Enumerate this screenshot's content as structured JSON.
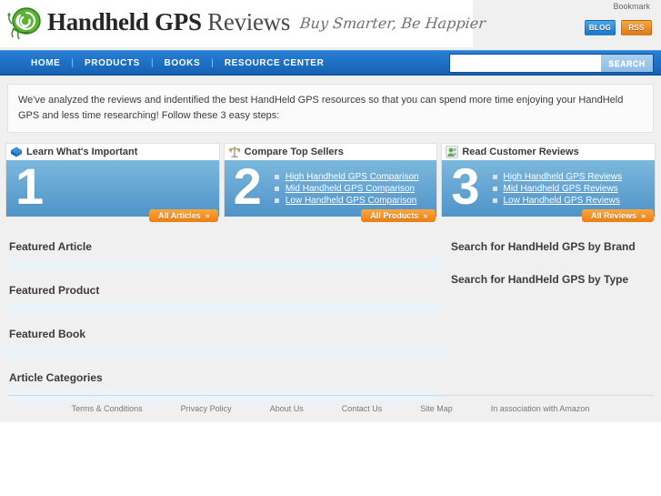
{
  "header": {
    "brand_bold": "Handheld GPS",
    "brand_light": "Reviews",
    "tagline": "Buy Smarter, Be Happier",
    "bookmark_label": "Bookmark",
    "blog_label": "BLOG",
    "rss_label": "RSS",
    "logo_icon": "snail-logo-icon"
  },
  "nav": {
    "items": [
      {
        "label": "HOME"
      },
      {
        "label": "PRODUCTS"
      },
      {
        "label": "BOOKS"
      },
      {
        "label": "RESOURCE CENTER"
      }
    ],
    "separator": "|",
    "search": {
      "value": "",
      "placeholder": "",
      "button_label": "SEARCH"
    }
  },
  "intro": {
    "text": "We've analyzed the reviews and indentified the best HandHeld GPS resources so that you can spend more time enjoying your HandHeld GPS and less time researching! Follow these 3 easy steps:"
  },
  "panels": [
    {
      "icon": "blue-diamond-icon",
      "title": "Learn What's Important",
      "number": "1",
      "links": [],
      "cta_label": "All Articles",
      "cta_chevron": "»"
    },
    {
      "icon": "scales-balance-icon",
      "title": "Compare Top Sellers",
      "number": "2",
      "links": [
        {
          "label": "High Handheld GPS Comparison"
        },
        {
          "label": "Mid Handheld GPS Comparison"
        },
        {
          "label": "Low Handheld GPS Comparison"
        }
      ],
      "cta_label": "All Products",
      "cta_chevron": "»"
    },
    {
      "icon": "customer-person-icon",
      "title": "Read Customer Reviews",
      "number": "3",
      "links": [
        {
          "label": "High Handheld GPS Reviews"
        },
        {
          "label": "Mid Handheld GPS Reviews"
        },
        {
          "label": "Low Handheld GPS Reviews"
        }
      ],
      "cta_label": "All Reviews",
      "cta_chevron": "»"
    }
  ],
  "featured_sections": [
    {
      "heading": "Featured Article"
    },
    {
      "heading": "Featured Product"
    },
    {
      "heading": "Featured Book"
    },
    {
      "heading": "Article Categories"
    }
  ],
  "side_sections": [
    {
      "heading": "Search for HandHeld GPS by Brand"
    },
    {
      "heading": "Search for HandHeld GPS by Type"
    }
  ],
  "footer": {
    "links": [
      {
        "label": "Terms & Conditions"
      },
      {
        "label": "Privacy Policy"
      },
      {
        "label": "About Us"
      },
      {
        "label": "Contact Us"
      },
      {
        "label": "Site Map"
      },
      {
        "label": "In association with Amazon"
      }
    ]
  },
  "colors": {
    "nav_blue": "#1461b4",
    "panel_blue": "#5f9fd0",
    "accent_orange": "#ef7d12",
    "page_bg": "#f0f0f0"
  }
}
